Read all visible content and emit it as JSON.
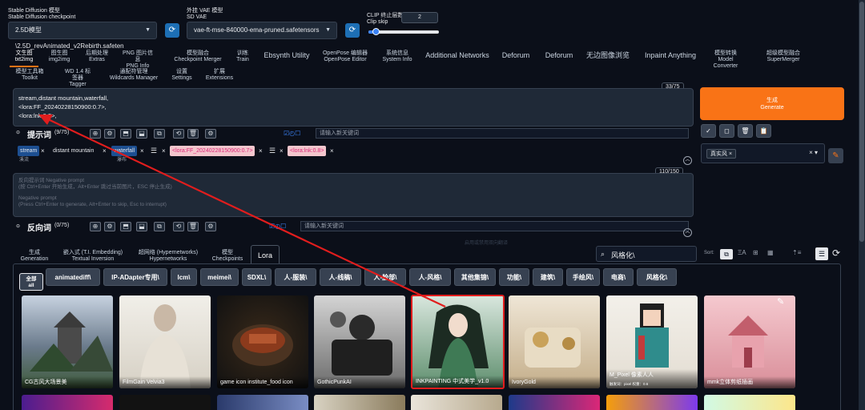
{
  "top": {
    "checkpoint_label_cn": "Stable Diffusion 模型",
    "checkpoint_label_en": "Stable Diffusion checkpoint",
    "checkpoint_value": "2.5D模型\\2.5D_revAnimated_v2Rebirth.safeten",
    "vae_label_cn": "外挂 VAE 模型",
    "vae_label_en": "SD VAE",
    "vae_value": "vae-ft-mse-840000-ema-pruned.safetensors",
    "clip_label_cn": "CLIP 终止层数",
    "clip_label_en": "Clip skip",
    "clip_value": "2",
    "clip_fraction": 0.1,
    "refresh_icon": "refresh-icon"
  },
  "main_tabs_row1": [
    {
      "cn": "文生图",
      "en": "txt2img"
    },
    {
      "cn": "图生图",
      "en": "img2img"
    },
    {
      "cn": "后期处理",
      "en": "Extras"
    },
    {
      "cn": "PNG 图片信息",
      "en": "PNG Info"
    },
    {
      "cn": "模型融合",
      "en": "Checkpoint Merger"
    },
    {
      "cn": "训练",
      "en": "Train"
    },
    {
      "cn": "Ebsynth Utility",
      "en": ""
    },
    {
      "cn": "OpenPose 编辑器",
      "en": "OpenPose Editor"
    },
    {
      "cn": "系统信息",
      "en": "System Info"
    },
    {
      "cn": "Additional Networks",
      "en": ""
    },
    {
      "cn": "Deforum",
      "en": ""
    },
    {
      "cn": "Deforum",
      "en": ""
    },
    {
      "cn": "无边图像浏览",
      "en": ""
    },
    {
      "cn": "Inpaint Anything",
      "en": ""
    },
    {
      "cn": "模型转换",
      "en": "Model Converter"
    },
    {
      "cn": "超级模型融合",
      "en": "SuperMerger"
    }
  ],
  "main_tabs_row2": [
    {
      "cn": "模型工具箱",
      "en": "Toolkit"
    },
    {
      "cn": "WD 1.4 标签器",
      "en": "Tagger"
    },
    {
      "cn": "通配符管理",
      "en": "Wildcards Manager"
    },
    {
      "cn": "设置",
      "en": "Settings"
    },
    {
      "cn": "扩展",
      "en": "Extensions"
    }
  ],
  "prompt": {
    "token_count": "33/75",
    "lines": [
      "stream,distant mountain,waterfall,",
      "<lora:FF_20240228150900:0.7>,",
      "<lora:lnk:0.8>,"
    ],
    "title": "提示词",
    "count": "(9/75)",
    "keyword_placeholder": "请输入新关键词",
    "tags": [
      "stream",
      "distant mountain",
      "waterfall",
      "<lora:FF_20240228150900:0.7>",
      "<lora:lnk:0.8>"
    ],
    "tag_sub": [
      "溪流",
      "瀑布"
    ]
  },
  "negative": {
    "token_count": "110/150",
    "placeholder_lines": [
      "反向提示词 Negative prompt",
      "(按 Ctrl+Enter 开始生成，Alt+Enter 跳过当前图片，ESC 停止生成)",
      "",
      "Negative prompt",
      "(Press Ctrl+Enter to generate, Alt+Enter to skip, Esc to interrupt)"
    ],
    "title": "反向词",
    "count": "(0/75)",
    "keyword_placeholder": "请输入新关键词",
    "faded_label": "启用或禁用双向翻译"
  },
  "generate": {
    "cn": "生成",
    "en": "Generate"
  },
  "styles": {
    "selected": "真实风",
    "tool_icons": [
      "check-icon",
      "square-icon",
      "trash-icon",
      "clipboard-icon"
    ]
  },
  "network_tabs": [
    {
      "cn": "生成",
      "en": "Generation"
    },
    {
      "cn": "嵌入式 (T.I. Embedding)",
      "en": "Textual Inversion"
    },
    {
      "cn": "超网络 (Hypernetworks)",
      "en": "Hypernetworks"
    },
    {
      "cn": "模型",
      "en": "Checkpoints"
    },
    {
      "cn": "Lora",
      "en": ""
    }
  ],
  "search": {
    "value": "风格化\\"
  },
  "sort_label": "Sort:",
  "categories": [
    {
      "cn": "全部",
      "en": "all"
    },
    {
      "cn": "animatediff\\",
      "en": ""
    },
    {
      "cn": "IP-ADapter专用\\",
      "en": ""
    },
    {
      "cn": "lcm\\",
      "en": ""
    },
    {
      "cn": "meimei\\",
      "en": ""
    },
    {
      "cn": "SDXL\\",
      "en": ""
    },
    {
      "cn": "人-服装\\",
      "en": ""
    },
    {
      "cn": "人-线稿\\",
      "en": ""
    },
    {
      "cn": "人-脸部\\",
      "en": ""
    },
    {
      "cn": "人-风格\\",
      "en": ""
    },
    {
      "cn": "其他集锦\\",
      "en": ""
    },
    {
      "cn": "功能\\",
      "en": ""
    },
    {
      "cn": "建筑\\",
      "en": ""
    },
    {
      "cn": "手绘风\\",
      "en": ""
    },
    {
      "cn": "电商\\",
      "en": ""
    },
    {
      "cn": "风格化\\",
      "en": ""
    }
  ],
  "cards": [
    {
      "title": "CG古风大场景美",
      "note": ""
    },
    {
      "title": "FilmGain Velvia3",
      "note": ""
    },
    {
      "title": "game icon institute_food icon",
      "note": ""
    },
    {
      "title": "GothicPunkAI",
      "note": ""
    },
    {
      "title": "INKPAINTING 中式美学_v1.0",
      "note": ""
    },
    {
      "title": "IvoryGold",
      "note": ""
    },
    {
      "title": "M_Pixel 像素人人",
      "note": "触发词：pixel 权重：0.6"
    },
    {
      "title": "mmk立体剪纸插画",
      "note": ""
    }
  ],
  "colors": {
    "accent": "#f97316",
    "blue": "#1d6fb5",
    "arrow": "#e11d1d",
    "bg": "#0b0f19",
    "panel": "#1f2937"
  }
}
